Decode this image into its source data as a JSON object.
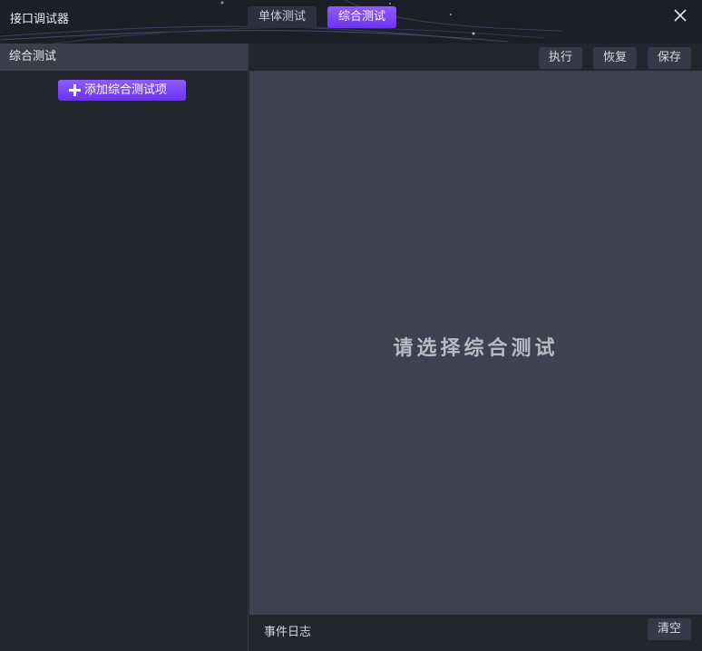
{
  "app": {
    "title": "接口调试器"
  },
  "tabs": [
    {
      "label": "单体测试",
      "active": false
    },
    {
      "label": "综合测试",
      "active": true
    }
  ],
  "sidebar": {
    "header": "综合测试",
    "add_button_label": "添加综合测试项"
  },
  "toolbar": {
    "execute_label": "执行",
    "restore_label": "恢复",
    "save_label": "保存"
  },
  "main": {
    "empty_message": "请选择综合测试"
  },
  "log": {
    "label": "事件日志",
    "clear_label": "清空"
  },
  "colors": {
    "accent": "#7b45f6",
    "background": "#23252f",
    "content_bg": "#3e4151"
  },
  "icons": {
    "close": "close-icon",
    "add": "plus-icon"
  }
}
